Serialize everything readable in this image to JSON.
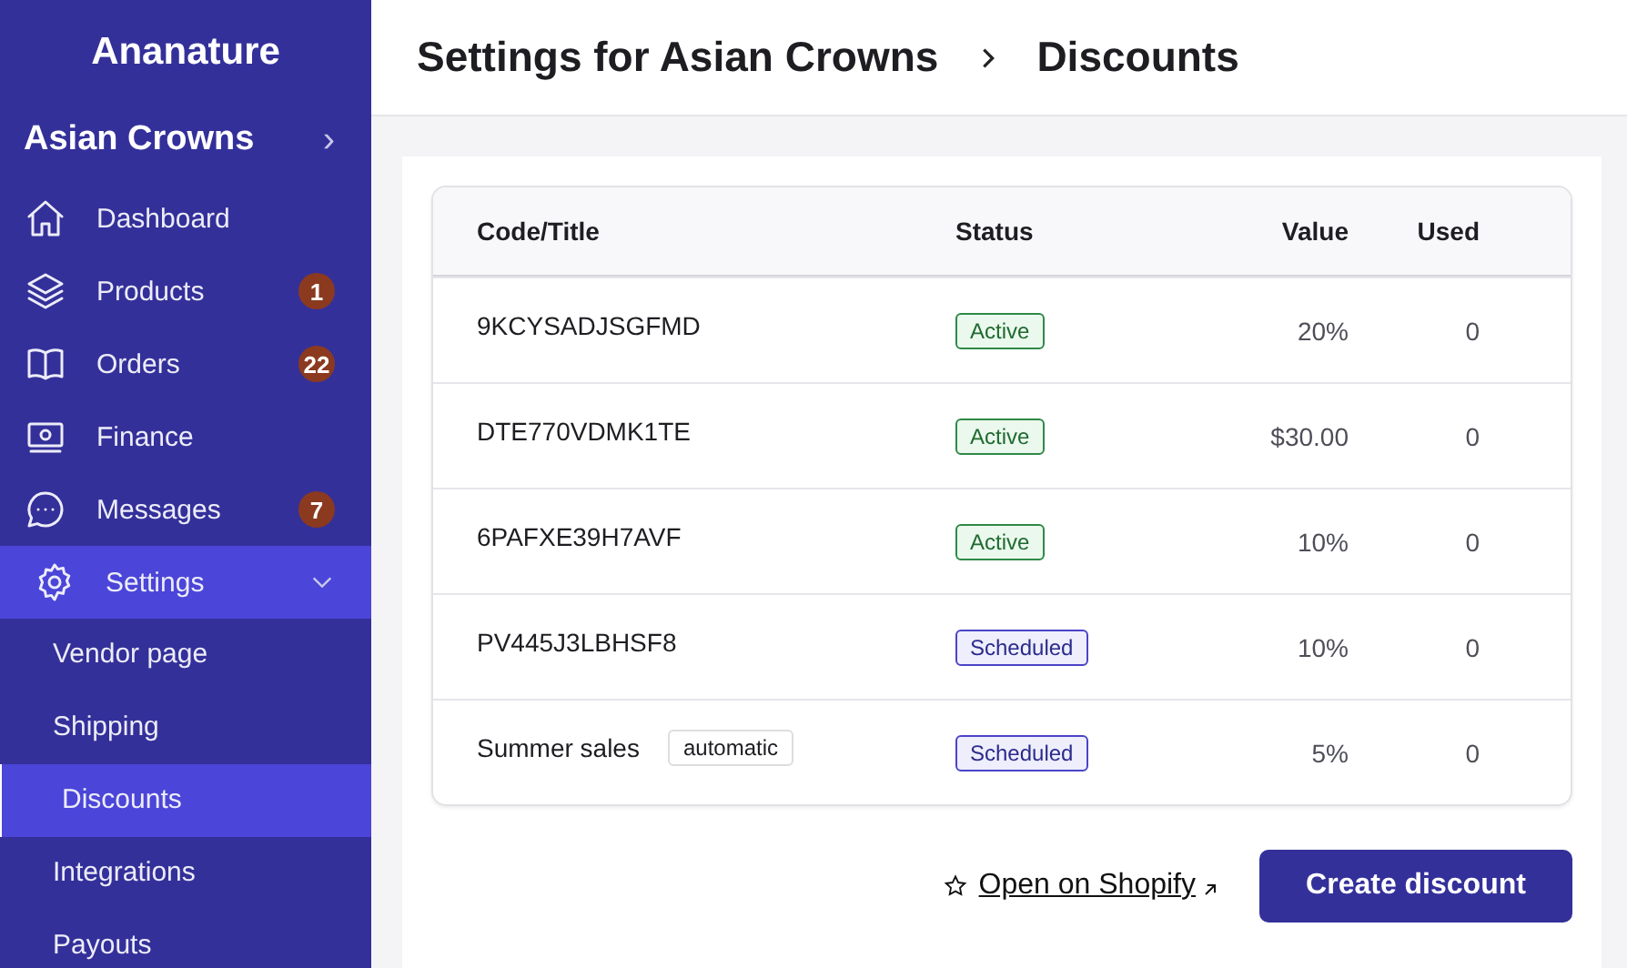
{
  "brand": "Ananature",
  "store": {
    "name": "Asian Crowns",
    "chevron": "›"
  },
  "nav": [
    {
      "label": "Dashboard",
      "selected": false
    },
    {
      "label": "Products",
      "badge": "1",
      "selected": false
    },
    {
      "label": "Orders",
      "badge": "22",
      "selected": false
    },
    {
      "label": "Finance",
      "selected": false
    },
    {
      "label": "Messages",
      "badge": "7",
      "selected": false
    },
    {
      "label": "Settings",
      "selected": true,
      "expanded": true,
      "children": [
        {
          "label": "Vendor page",
          "selected": false
        },
        {
          "label": "Shipping",
          "selected": false
        },
        {
          "label": "Discounts",
          "selected": true
        },
        {
          "label": "Integrations",
          "selected": false
        },
        {
          "label": "Payouts",
          "selected": false
        }
      ]
    }
  ],
  "breadcrumb": [
    "Settings for Asian Crowns",
    "Discounts"
  ],
  "table": {
    "columns": [
      "Code/Title",
      "Status",
      "Value",
      "Used"
    ],
    "rows": [
      {
        "code": "9KCYSADJSGFMD",
        "status": {
          "label": "Active",
          "kind": "active"
        },
        "value": "20%",
        "used": "0"
      },
      {
        "code": "DTE770VDMK1TE",
        "status": {
          "label": "Active",
          "kind": "active"
        },
        "value": "$30.00",
        "used": "0"
      },
      {
        "code": "6PAFXE39H7AVF",
        "status": {
          "label": "Active",
          "kind": "active"
        },
        "value": "10%",
        "used": "0"
      },
      {
        "code": "PV445J3LBHSF8",
        "status": {
          "label": "Scheduled",
          "kind": "scheduled"
        },
        "value": "10%",
        "used": "0"
      },
      {
        "code": "Summer sales",
        "tag": "automatic",
        "status": {
          "label": "Scheduled",
          "kind": "scheduled"
        },
        "value": "5%",
        "used": "0"
      }
    ]
  },
  "link": "Open on Shopify",
  "button": "Create discount"
}
